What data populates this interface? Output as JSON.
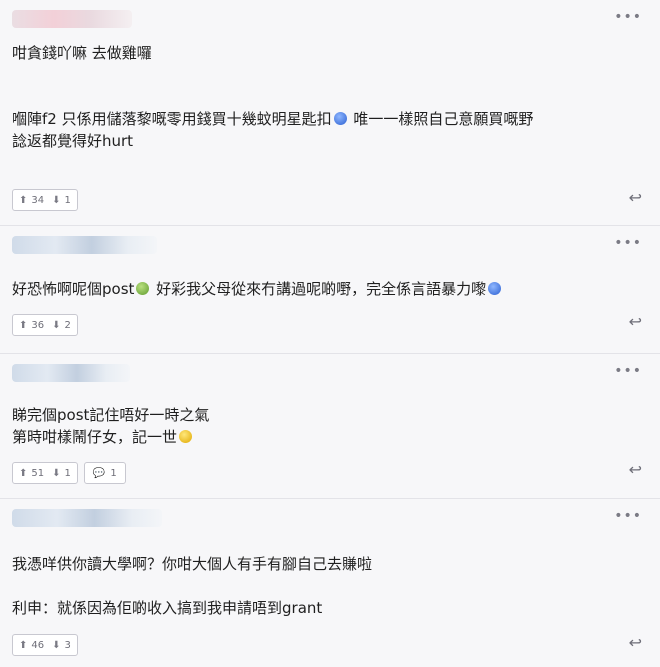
{
  "comments": [
    {
      "lines": [
        "咁貪錢吖嘛 去做雞囉",
        "",
        "",
        "嗰陣f2 只係用儲落黎嘅零用錢買十幾蚊明星匙扣",
        "諗返都覺得好hurt"
      ],
      "line2_suffix": " 唯一一樣照自己意願買嘅野",
      "up": "34",
      "down": "1"
    },
    {
      "lines": [
        "好恐怖啊呢個post"
      ],
      "line1_mid": " 好彩我父母從來冇講過呢啲嘢，完全係言語暴力嚟",
      "up": "36",
      "down": "2"
    },
    {
      "lines": [
        "睇完個post記住唔好一時之氣",
        "第時咁樣鬧仔女，記一世"
      ],
      "up": "51",
      "down": "1",
      "replies": "1"
    },
    {
      "lines": [
        "我憑咩供你讀大學啊？你咁大個人有手有腳自己去賺啦",
        "",
        "利申：就係因為佢啲收入搞到我申請唔到grant"
      ],
      "up": "46",
      "down": "3"
    }
  ],
  "icons": {
    "more": "more-dots-icon",
    "up": "upvote-arrow-icon",
    "down": "downvote-arrow-icon",
    "reply": "reply-arrow-icon",
    "comment": "comment-bubble-icon"
  }
}
